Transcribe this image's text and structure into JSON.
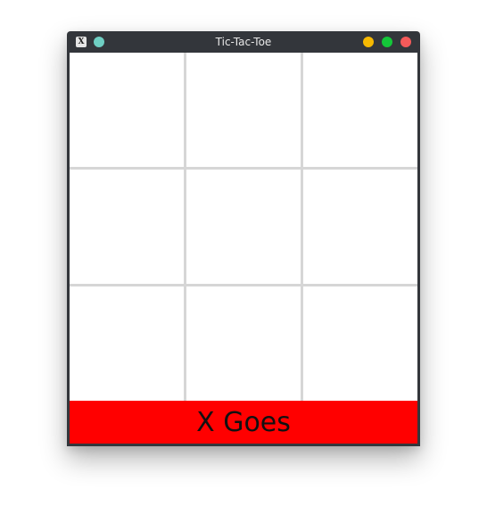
{
  "window": {
    "title": "Tic-Tac-Toe",
    "app_icon": "X",
    "pin_icon_color": "#6fcfc3",
    "controls": {
      "minimize_color": "#f6b902",
      "maximize_color": "#14c739",
      "close_color": "#f55a5a"
    }
  },
  "board": {
    "cells": [
      "",
      "",
      "",
      "",
      "",
      "",
      "",
      "",
      ""
    ]
  },
  "status": {
    "text": "X Goes",
    "background": "#ff0000"
  }
}
